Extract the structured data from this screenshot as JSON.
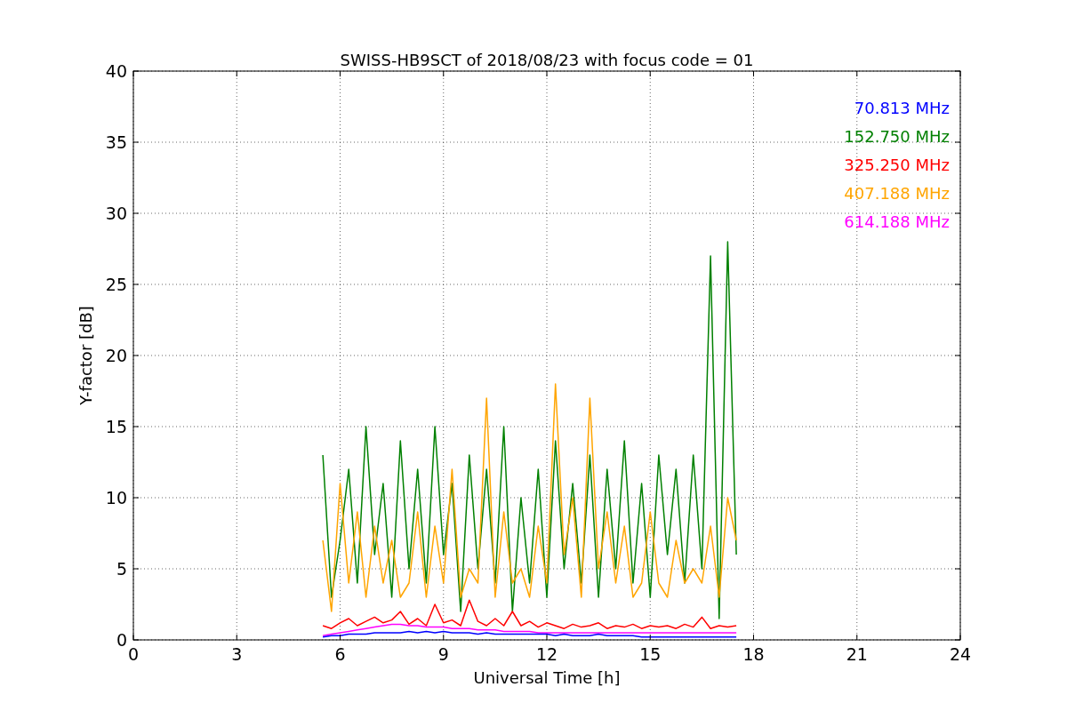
{
  "chart_data": {
    "type": "line",
    "title": "SWISS-HB9SCT of 2018/08/23 with focus code = 01",
    "xlabel": "Universal Time [h]",
    "ylabel": "Y-factor [dB]",
    "x": [
      5.5,
      5.75,
      6,
      6.25,
      6.5,
      6.75,
      7,
      7.25,
      7.5,
      7.75,
      8,
      8.25,
      8.5,
      8.75,
      9,
      9.25,
      9.5,
      9.75,
      10,
      10.25,
      10.5,
      10.75,
      11,
      11.25,
      11.5,
      11.75,
      12,
      12.25,
      12.5,
      12.75,
      13,
      13.25,
      13.5,
      13.75,
      14,
      14.25,
      14.5,
      14.75,
      15,
      15.25,
      15.5,
      15.75,
      16,
      16.25,
      16.5,
      16.75,
      17,
      17.25,
      17.5
    ],
    "series": [
      {
        "name": "70.813 MHz",
        "color": "#0000ff",
        "values": [
          0.2,
          0.3,
          0.3,
          0.4,
          0.4,
          0.4,
          0.5,
          0.5,
          0.5,
          0.5,
          0.6,
          0.5,
          0.6,
          0.5,
          0.6,
          0.5,
          0.5,
          0.5,
          0.4,
          0.5,
          0.4,
          0.4,
          0.4,
          0.4,
          0.4,
          0.4,
          0.4,
          0.3,
          0.4,
          0.3,
          0.3,
          0.3,
          0.4,
          0.3,
          0.3,
          0.3,
          0.3,
          0.2,
          0.2,
          0.2,
          0.2,
          0.2,
          0.2,
          0.2,
          0.2,
          0.2,
          0.2,
          0.2,
          0.2
        ]
      },
      {
        "name": "152.750 MHz",
        "color": "#008000",
        "values": [
          13,
          3,
          7,
          12,
          4,
          15,
          6,
          11,
          3,
          14,
          5,
          12,
          4,
          15,
          6,
          11,
          2,
          13,
          5,
          12,
          4,
          15,
          2,
          10,
          4,
          12,
          3,
          14,
          5,
          11,
          4,
          13,
          3,
          12,
          5,
          14,
          4,
          11,
          3,
          13,
          6,
          12,
          4,
          13,
          5,
          27,
          1.5,
          28,
          6
        ]
      },
      {
        "name": "325.250 MHz",
        "color": "#ff0000",
        "values": [
          1,
          0.8,
          1.2,
          1.5,
          1,
          1.3,
          1.6,
          1.2,
          1.4,
          2,
          1.1,
          1.5,
          1,
          2.5,
          1.2,
          1.4,
          1,
          2.8,
          1.3,
          1,
          1.5,
          1,
          2,
          1,
          1.3,
          0.9,
          1.2,
          1,
          0.8,
          1.1,
          0.9,
          1,
          1.2,
          0.8,
          1,
          0.9,
          1.1,
          0.8,
          1,
          0.9,
          1,
          0.8,
          1.1,
          0.9,
          1.6,
          0.8,
          1,
          0.9,
          1
        ]
      },
      {
        "name": "407.188 MHz",
        "color": "#ffa500",
        "values": [
          7,
          2,
          11,
          4,
          9,
          3,
          8,
          4,
          7,
          3,
          4,
          9,
          3,
          8,
          4,
          12,
          3,
          5,
          4,
          17,
          3,
          9,
          4,
          5,
          3,
          8,
          4,
          18,
          6,
          10,
          3,
          17,
          5,
          9,
          4,
          8,
          3,
          4,
          9,
          4,
          3,
          7,
          4,
          5,
          4,
          8,
          3,
          10,
          7
        ]
      },
      {
        "name": "614.188 MHz",
        "color": "#ff00ff",
        "values": [
          0.3,
          0.4,
          0.5,
          0.6,
          0.7,
          0.8,
          0.9,
          1,
          1.1,
          1.1,
          1,
          1,
          0.9,
          0.9,
          0.9,
          0.8,
          0.8,
          0.8,
          0.7,
          0.7,
          0.7,
          0.6,
          0.6,
          0.6,
          0.6,
          0.5,
          0.5,
          0.5,
          0.5,
          0.5,
          0.5,
          0.5,
          0.5,
          0.5,
          0.5,
          0.5,
          0.5,
          0.5,
          0.5,
          0.5,
          0.5,
          0.5,
          0.5,
          0.5,
          0.5,
          0.5,
          0.5,
          0.5,
          0.5
        ]
      }
    ],
    "grid": true,
    "xlim": [
      0,
      24
    ],
    "ylim": [
      0,
      40
    ],
    "xticks": [
      0,
      3,
      6,
      9,
      12,
      15,
      18,
      21,
      24
    ],
    "yticks": [
      0,
      5,
      10,
      15,
      20,
      25,
      30,
      35,
      40
    ]
  }
}
